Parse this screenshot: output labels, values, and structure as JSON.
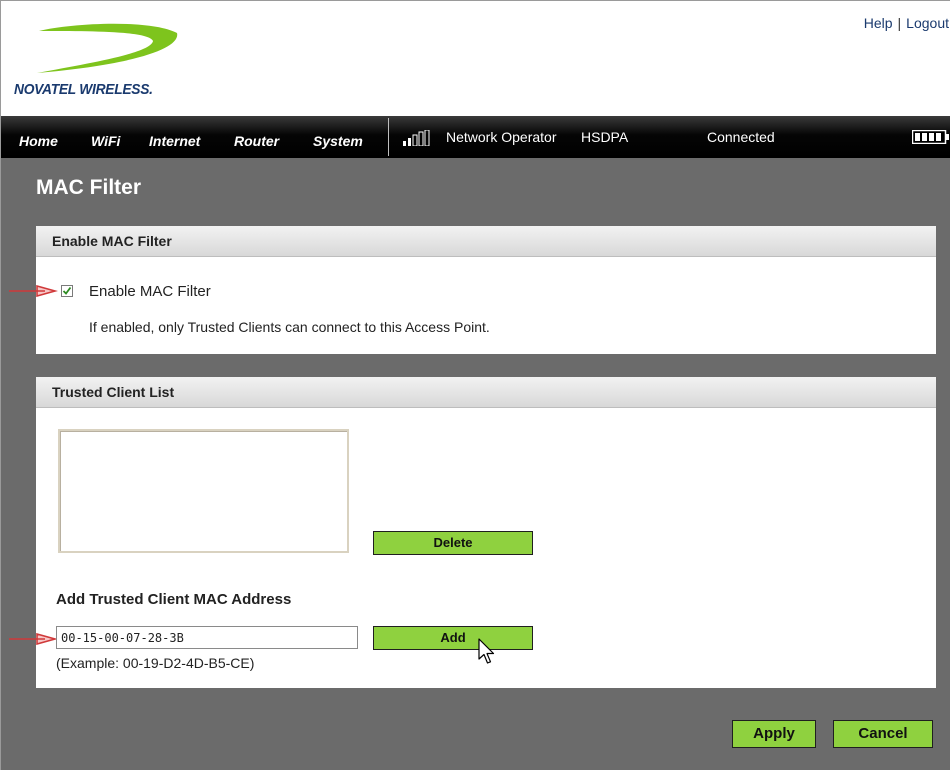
{
  "brand": {
    "name": "NOVATEL WIRELESS."
  },
  "header": {
    "links": [
      "Help",
      "Logout"
    ],
    "separator": "|"
  },
  "nav": {
    "items": [
      "Home",
      "WiFi",
      "Internet",
      "Router",
      "System"
    ],
    "status": {
      "operator": "Network Operator",
      "network": "HSDPA",
      "connection": "Connected"
    },
    "icons": {
      "signal": "signal-strength-icon",
      "battery": "battery-icon"
    }
  },
  "page": {
    "title": "MAC Filter"
  },
  "enable_panel": {
    "heading": "Enable MAC Filter",
    "checkbox_label": "Enable MAC Filter",
    "checked": true,
    "info": "If enabled, only Trusted Clients can connect to this Access Point."
  },
  "trusted_panel": {
    "heading": "Trusted Client List",
    "clients": [],
    "delete_label": "Delete",
    "add_heading": "Add Trusted Client MAC Address",
    "mac_value": "00-15-00-07-28-3B",
    "add_label": "Add",
    "example": "(Example: 00-19-D2-4D-B5-CE)"
  },
  "footer": {
    "apply_label": "Apply",
    "cancel_label": "Cancel"
  },
  "colors": {
    "accent_green": "#8fd13f",
    "brand_blue": "#1a3a6e",
    "swoosh_green": "#7ec41d",
    "nav_black": "#000000",
    "content_gray": "#6b6b6b",
    "arrow_red": "#d0393a"
  }
}
